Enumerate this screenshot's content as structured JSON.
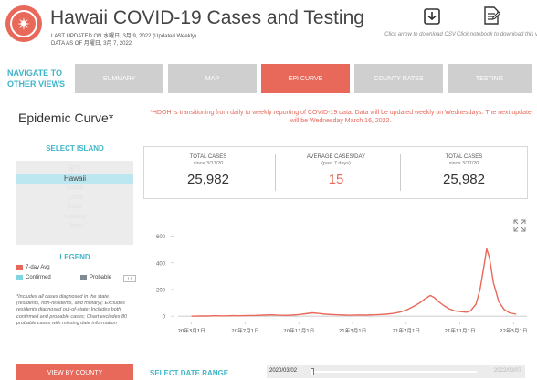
{
  "header": {
    "title": "Hawaii COVID-19 Cases and Testing",
    "last_updated": "LAST UPDATED ON 水曜日, 3月 9, 2022 (Updated Weekly)",
    "data_as_of": "DATA AS OF 月曜日, 3月 7, 2022",
    "download_text": "Click arrow to download CSV",
    "notebook_text": "Click notebook to download this view",
    "download_icon": "download-arrow-icon",
    "notebook_icon": "notebook-icon"
  },
  "nav": {
    "label_line1": "NAVIGATE TO",
    "label_line2": "OTHER VIEWS",
    "items": [
      {
        "label": "SUMMARY"
      },
      {
        "label": "MAP"
      },
      {
        "label": "EPI CURVE"
      },
      {
        "label": "COUNTY RATES"
      },
      {
        "label": "TESTING"
      }
    ],
    "active_index": 2
  },
  "main": {
    "title": "Epidemic Curve*",
    "notice": "*HDOH is transitioning from daily to weekly reporting of COVID-19 data. Data will be updated weekly on Wednesdays. The next update will be Wednesday March 16, 2022."
  },
  "island_selector": {
    "heading": "SELECT ISLAND",
    "options": [
      "全て",
      "Hawaii",
      "Kauai",
      "Lanai",
      "Maui",
      "Molokai",
      "Oahu"
    ],
    "selected": "Hawaii"
  },
  "legend": {
    "heading": "LEGEND",
    "items": [
      {
        "label": "7-day Avg",
        "color": "#e8685a"
      },
      {
        "label": "Confirmed",
        "color": "#7fd6e0"
      },
      {
        "label": "Probable",
        "color": "#7f8a94"
      }
    ],
    "nav_label": "‹ ›",
    "footnote": "*Includes all cases diagnosed in the state (residents, non-residents, and military); Excludes residents diagnosed out-of-state; Includes both confirmed and probable cases; Chart excludes 80 probable cases with missing date information"
  },
  "view_by_county": "VIEW BY COUNTY",
  "stats": {
    "total_cases_left": {
      "label": "TOTAL CASES",
      "sub": "since 3/17/20",
      "value": "25,982"
    },
    "avg_cases": {
      "label": "AVERAGE CASES/DAY",
      "sub": "(past 7 days)",
      "value": "15"
    },
    "total_cases_right": {
      "label": "TOTAL CASES",
      "sub": "since 3/17/20",
      "value": "25,982"
    }
  },
  "date_range": {
    "heading": "SELECT DATE RANGE",
    "start": "2020/03/02",
    "end": "2022/03/07"
  },
  "chart_data": {
    "type": "line",
    "title": "",
    "xlabel": "",
    "ylabel": "",
    "ylim": [
      -40,
      700
    ],
    "yticks": [
      0,
      200,
      400,
      600
    ],
    "xtick_labels": [
      "20年3月1日",
      "20年7月1日",
      "20年11月1日",
      "21年3月1日",
      "21年7月1日",
      "21年11月1日",
      "22年3月1日"
    ],
    "xtick_months": [
      0,
      4,
      8,
      12,
      16,
      20,
      24
    ],
    "grid": false,
    "series": [
      {
        "name": "7-day Avg",
        "color": "#e8685a",
        "points": [
          [
            0.0,
            0
          ],
          [
            0.6,
            2
          ],
          [
            1.2,
            1
          ],
          [
            1.8,
            3
          ],
          [
            2.4,
            2
          ],
          [
            3.0,
            4
          ],
          [
            3.6,
            3
          ],
          [
            4.2,
            5
          ],
          [
            4.8,
            6
          ],
          [
            5.4,
            8
          ],
          [
            6.0,
            10
          ],
          [
            6.5,
            7
          ],
          [
            7.0,
            6
          ],
          [
            7.5,
            8
          ],
          [
            8.0,
            12
          ],
          [
            8.5,
            18
          ],
          [
            9.0,
            25
          ],
          [
            9.5,
            20
          ],
          [
            10.0,
            15
          ],
          [
            10.5,
            12
          ],
          [
            11.0,
            10
          ],
          [
            11.5,
            8
          ],
          [
            12.0,
            7
          ],
          [
            12.5,
            9
          ],
          [
            13.0,
            8
          ],
          [
            13.5,
            10
          ],
          [
            14.0,
            12
          ],
          [
            14.5,
            15
          ],
          [
            15.0,
            20
          ],
          [
            15.5,
            30
          ],
          [
            16.0,
            45
          ],
          [
            16.5,
            70
          ],
          [
            17.0,
            100
          ],
          [
            17.4,
            130
          ],
          [
            17.8,
            155
          ],
          [
            18.1,
            140
          ],
          [
            18.4,
            110
          ],
          [
            18.8,
            80
          ],
          [
            19.2,
            55
          ],
          [
            19.6,
            40
          ],
          [
            20.0,
            35
          ],
          [
            20.5,
            30
          ],
          [
            20.8,
            40
          ],
          [
            21.2,
            90
          ],
          [
            21.5,
            200
          ],
          [
            21.8,
            380
          ],
          [
            22.0,
            505
          ],
          [
            22.2,
            440
          ],
          [
            22.5,
            250
          ],
          [
            22.9,
            110
          ],
          [
            23.3,
            50
          ],
          [
            23.7,
            25
          ],
          [
            24.2,
            15
          ]
        ]
      }
    ]
  }
}
